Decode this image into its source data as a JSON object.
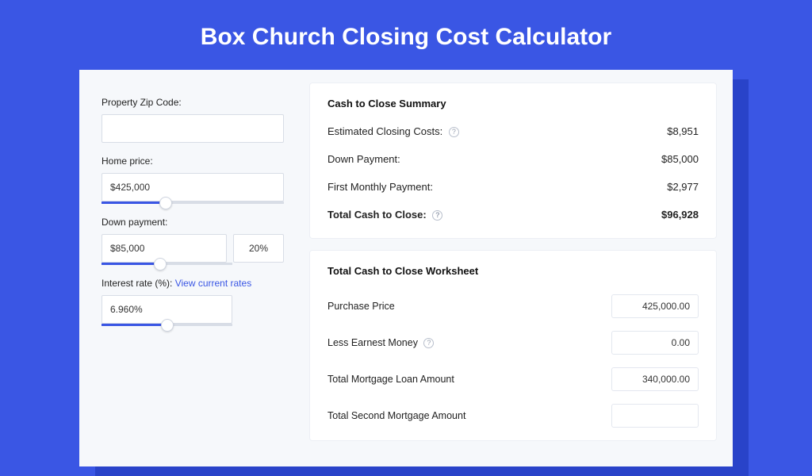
{
  "title": "Box Church Closing Cost Calculator",
  "inputs": {
    "zip": {
      "label": "Property Zip Code:",
      "value": ""
    },
    "home_price": {
      "label": "Home price:",
      "value": "$425,000",
      "slider_pct": 35
    },
    "down_payment": {
      "label": "Down payment:",
      "value": "$85,000",
      "pct_display": "20%",
      "slider_pct": 45
    },
    "interest_rate": {
      "label_prefix": "Interest rate (%): ",
      "link": "View current rates",
      "value": "6.960%",
      "slider_pct": 50
    }
  },
  "summary": {
    "title": "Cash to Close Summary",
    "rows": {
      "closing_costs": {
        "label": "Estimated Closing Costs:",
        "value": "$8,951",
        "help": true
      },
      "down_payment": {
        "label": "Down Payment:",
        "value": "$85,000"
      },
      "first_monthly": {
        "label": "First Monthly Payment:",
        "value": "$2,977"
      },
      "total": {
        "label": "Total Cash to Close:",
        "value": "$96,928",
        "help": true
      }
    }
  },
  "worksheet": {
    "title": "Total Cash to Close Worksheet",
    "rows": {
      "purchase_price": {
        "label": "Purchase Price",
        "value": "425,000.00"
      },
      "less_earnest": {
        "label": "Less Earnest Money",
        "value": "0.00",
        "help": true
      },
      "total_mortgage": {
        "label": "Total Mortgage Loan Amount",
        "value": "340,000.00"
      },
      "second_mortgage": {
        "label": "Total Second Mortgage Amount",
        "value": ""
      }
    }
  }
}
